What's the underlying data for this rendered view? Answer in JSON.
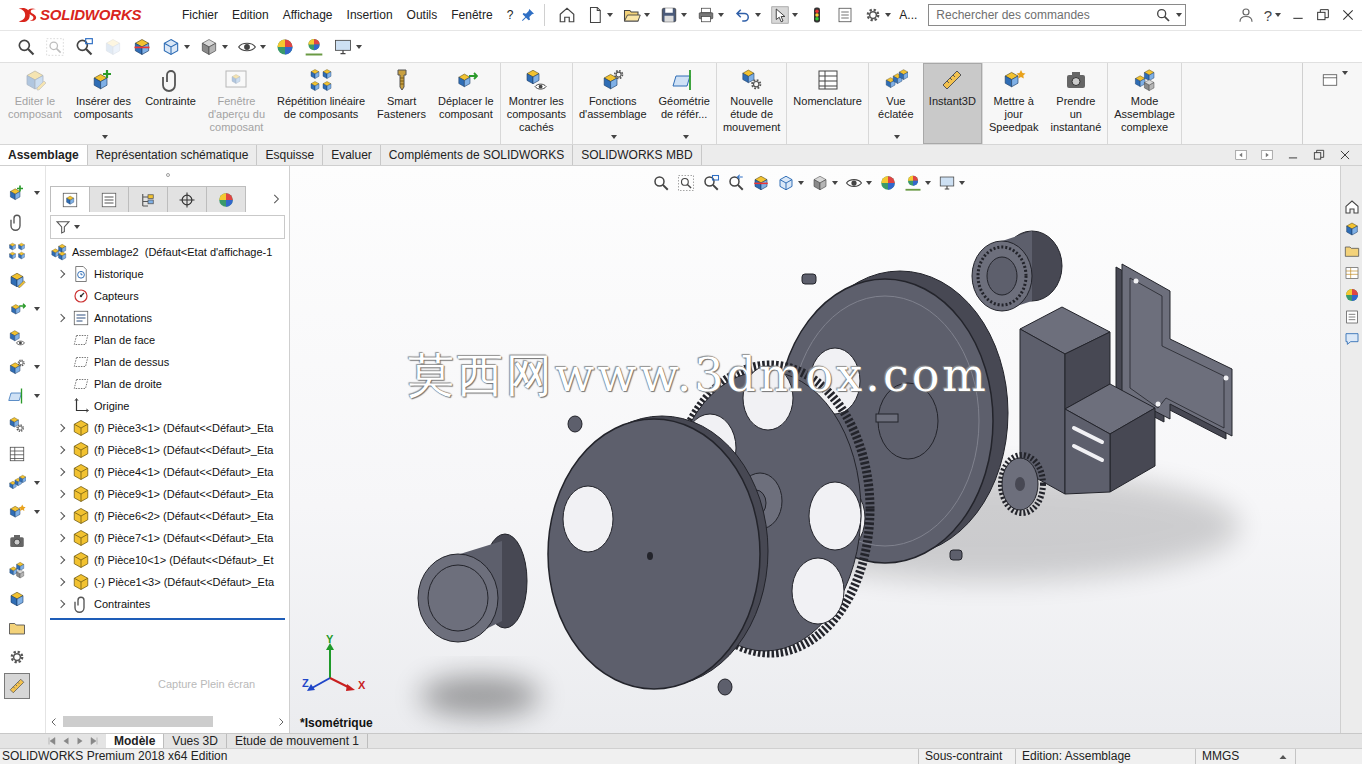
{
  "app": {
    "name": "SOLIDWORKS"
  },
  "menu": [
    {
      "label": "Fichier"
    },
    {
      "label": "Edition"
    },
    {
      "label": "Affichage"
    },
    {
      "label": "Insertion"
    },
    {
      "label": "Outils"
    },
    {
      "label": "Fenêtre"
    },
    {
      "label": "?"
    }
  ],
  "quick_access": {
    "overflow": "A..."
  },
  "search": {
    "placeholder": "Rechercher des commandes"
  },
  "help": "?",
  "ribbon": {
    "groups": [
      [
        {
          "label_lines": [
            "Editer le",
            "composant"
          ],
          "disabled": true,
          "selected": false,
          "has_menu": false
        },
        {
          "label_lines": [
            "Insérer des",
            "composants"
          ],
          "disabled": false,
          "selected": false,
          "has_menu": true
        },
        {
          "label_lines": [
            "Contrainte"
          ],
          "disabled": false,
          "selected": false,
          "has_menu": false
        },
        {
          "label_lines": [
            "Fenêtre",
            "d'aperçu du",
            "composant"
          ],
          "disabled": true,
          "selected": false,
          "has_menu": false
        },
        {
          "label_lines": [
            "Répétition linéaire",
            "de composants"
          ],
          "disabled": false,
          "selected": false,
          "has_menu": false
        },
        {
          "label_lines": [
            "Smart",
            "Fasteners"
          ],
          "disabled": false,
          "selected": false,
          "has_menu": false
        },
        {
          "label_lines": [
            "Déplacer le",
            "composant"
          ],
          "disabled": false,
          "selected": false,
          "has_menu": false
        }
      ],
      [
        {
          "label_lines": [
            "Montrer les",
            "composants",
            "cachés"
          ],
          "disabled": false,
          "selected": false,
          "has_menu": false
        }
      ],
      [
        {
          "label_lines": [
            "Fonctions",
            "d'assemblage"
          ],
          "disabled": false,
          "selected": false,
          "has_menu": true
        },
        {
          "label_lines": [
            "Géométrie",
            "de référ..."
          ],
          "disabled": false,
          "selected": false,
          "has_menu": true
        }
      ],
      [
        {
          "label_lines": [
            "Nouvelle",
            "étude de",
            "mouvement"
          ],
          "disabled": false,
          "selected": false,
          "has_menu": false
        }
      ],
      [
        {
          "label_lines": [
            "Nomenclature"
          ],
          "disabled": false,
          "selected": false,
          "has_menu": false
        }
      ],
      [
        {
          "label_lines": [
            "Vue",
            "éclatée"
          ],
          "disabled": false,
          "selected": false,
          "has_menu": true
        },
        {
          "label_lines": [
            "Instant3D"
          ],
          "disabled": false,
          "selected": true,
          "has_menu": false
        }
      ],
      [
        {
          "label_lines": [
            "Mettre à",
            "jour",
            "Speedpak"
          ],
          "disabled": false,
          "selected": false,
          "has_menu": false
        },
        {
          "label_lines": [
            "Prendre",
            "un",
            "instantané"
          ],
          "disabled": false,
          "selected": false,
          "has_menu": false
        }
      ],
      [
        {
          "label_lines": [
            "Mode",
            "Assemblage",
            "complexe"
          ],
          "disabled": false,
          "selected": false,
          "has_menu": false
        }
      ]
    ]
  },
  "ribbon_tabs": [
    {
      "label": "Assemblage",
      "selected": true
    },
    {
      "label": "Représentation schématique",
      "selected": false
    },
    {
      "label": "Esquisse",
      "selected": false
    },
    {
      "label": "Evaluer",
      "selected": false
    },
    {
      "label": "Compléments de SOLIDWORKS",
      "selected": false
    },
    {
      "label": "SOLIDWORKS MBD",
      "selected": false
    }
  ],
  "left_toolbar": [
    {
      "selected": false
    },
    {
      "selected": false
    },
    {
      "selected": false
    },
    {
      "selected": false
    },
    {
      "selected": false
    },
    {
      "selected": false
    },
    {
      "selected": false
    },
    {
      "selected": false
    },
    {
      "selected": false
    },
    {
      "selected": false
    },
    {
      "selected": false
    },
    {
      "selected": false
    },
    {
      "selected": false
    },
    {
      "selected": false
    },
    {
      "selected": false
    },
    {
      "selected": false
    },
    {
      "selected": false
    },
    {
      "selected": true
    }
  ],
  "feature_manager": {
    "tabs": [
      {
        "selected": true
      },
      {
        "selected": false
      },
      {
        "selected": false
      },
      {
        "selected": false
      },
      {
        "selected": false
      }
    ],
    "tree": [
      {
        "label": "Assemblage2  (Défaut<Etat d'affichage-1",
        "level": 0,
        "kind": "assembly",
        "expandable": false
      },
      {
        "label": "Historique",
        "level": 1,
        "kind": "history",
        "expandable": true
      },
      {
        "label": "Capteurs",
        "level": 1,
        "kind": "sensor",
        "expandable": false
      },
      {
        "label": "Annotations",
        "level": 1,
        "kind": "annotation",
        "expandable": true
      },
      {
        "label": "Plan de face",
        "level": 1,
        "kind": "plane",
        "expandable": false
      },
      {
        "label": "Plan de dessus",
        "level": 1,
        "kind": "plane",
        "expandable": false
      },
      {
        "label": "Plan de droite",
        "level": 1,
        "kind": "plane",
        "expandable": false
      },
      {
        "label": "Origine",
        "level": 1,
        "kind": "origin",
        "expandable": false
      },
      {
        "label": "(f) Pièce3<1> (Défaut<<Défaut>_Eta",
        "level": 1,
        "kind": "part",
        "expandable": true
      },
      {
        "label": "(f) Pièce8<1> (Défaut<<Défaut>_Eta",
        "level": 1,
        "kind": "part",
        "expandable": true
      },
      {
        "label": "(f) Pièce4<1> (Défaut<<Défaut>_Eta",
        "level": 1,
        "kind": "part",
        "expandable": true
      },
      {
        "label": "(f) Pièce9<1> (Défaut<<Défaut>_Eta",
        "level": 1,
        "kind": "part",
        "expandable": true
      },
      {
        "label": "(f) Pièce6<2> (Défaut<<Défaut>_Eta",
        "level": 1,
        "kind": "part",
        "expandable": true
      },
      {
        "label": "(f) Pièce7<1> (Défaut<<Défaut>_Eta",
        "level": 1,
        "kind": "part",
        "expandable": true
      },
      {
        "label": "(f) Pièce10<1> (Défaut<<Défaut>_Et",
        "level": 1,
        "kind": "part",
        "expandable": true
      },
      {
        "label": "(-) Pièce1<3> (Défaut<<Défaut>_Eta",
        "level": 1,
        "kind": "part",
        "expandable": true
      },
      {
        "label": "Contraintes",
        "level": 1,
        "kind": "mates",
        "expandable": true
      }
    ],
    "ghost_text": "Capture Plein écran"
  },
  "graphics": {
    "watermark": "莫西网www.3dmox.com",
    "view_name": "*Isométrique",
    "triad": [
      {
        "axis": "Y",
        "color": "#1f9a2a"
      },
      {
        "axis": "Z",
        "color": "#1f45c8"
      },
      {
        "axis": "X",
        "color": "#c81f1f"
      }
    ]
  },
  "bottom_tabs": [
    {
      "label": "Modèle",
      "selected": true
    },
    {
      "label": "Vues 3D",
      "selected": false
    },
    {
      "label": "Etude de mouvement 1",
      "selected": false
    }
  ],
  "status_bar": [
    {
      "text": "SOLIDWORKS Premium 2018 x64 Edition"
    },
    {
      "text": "Sous-contraint"
    },
    {
      "text": "Edition: Assemblage"
    },
    {
      "text": "MMGS"
    }
  ]
}
